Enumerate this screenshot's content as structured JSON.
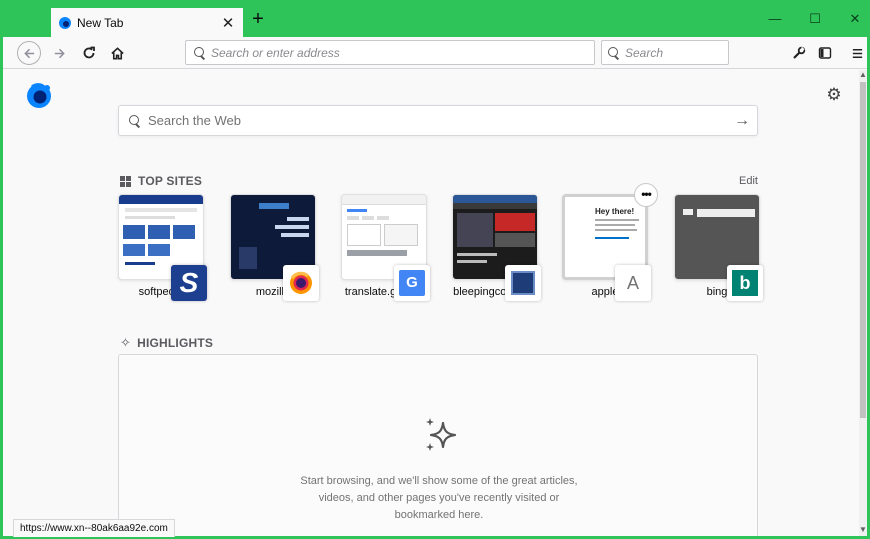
{
  "browser": {
    "tab": {
      "title": "New Tab",
      "close_glyph": "✕"
    },
    "newtab_glyph": "+",
    "window_controls": {
      "minimize": "—",
      "maximize": "☐",
      "close": "✕"
    },
    "nav": {
      "back_icon": "back-arrow-icon",
      "forward_icon": "forward-arrow-icon",
      "reload_icon": "reload-icon",
      "home_icon": "home-icon"
    },
    "urlbar_placeholder": "Search or enter address",
    "searchbar_placeholder": "Search",
    "toolbar_icons": [
      "wrench-icon",
      "sidebar-icon",
      "menu-icon"
    ]
  },
  "newtab": {
    "search_placeholder": "Search the Web",
    "top_sites_title": "TOP SITES",
    "edit_label": "Edit",
    "top_sites": [
      {
        "label": "softpedia"
      },
      {
        "label": "mozilla"
      },
      {
        "label": "translate.google"
      },
      {
        "label": "bleepingcompu..."
      },
      {
        "label": "apple",
        "badge_letter": "A"
      },
      {
        "label": "bing"
      }
    ],
    "highlights_title": "HIGHLIGHTS",
    "highlights_empty_text": "Start browsing, and we'll show some of the great articles, videos, and other pages you've recently visited or bookmarked here."
  },
  "status_url": "https://www.xn--80ak6aa92e.com",
  "colors": {
    "titlebar": "#2ec45a",
    "accent_blue": "#0a84ff",
    "bing_teal": "#008373"
  }
}
